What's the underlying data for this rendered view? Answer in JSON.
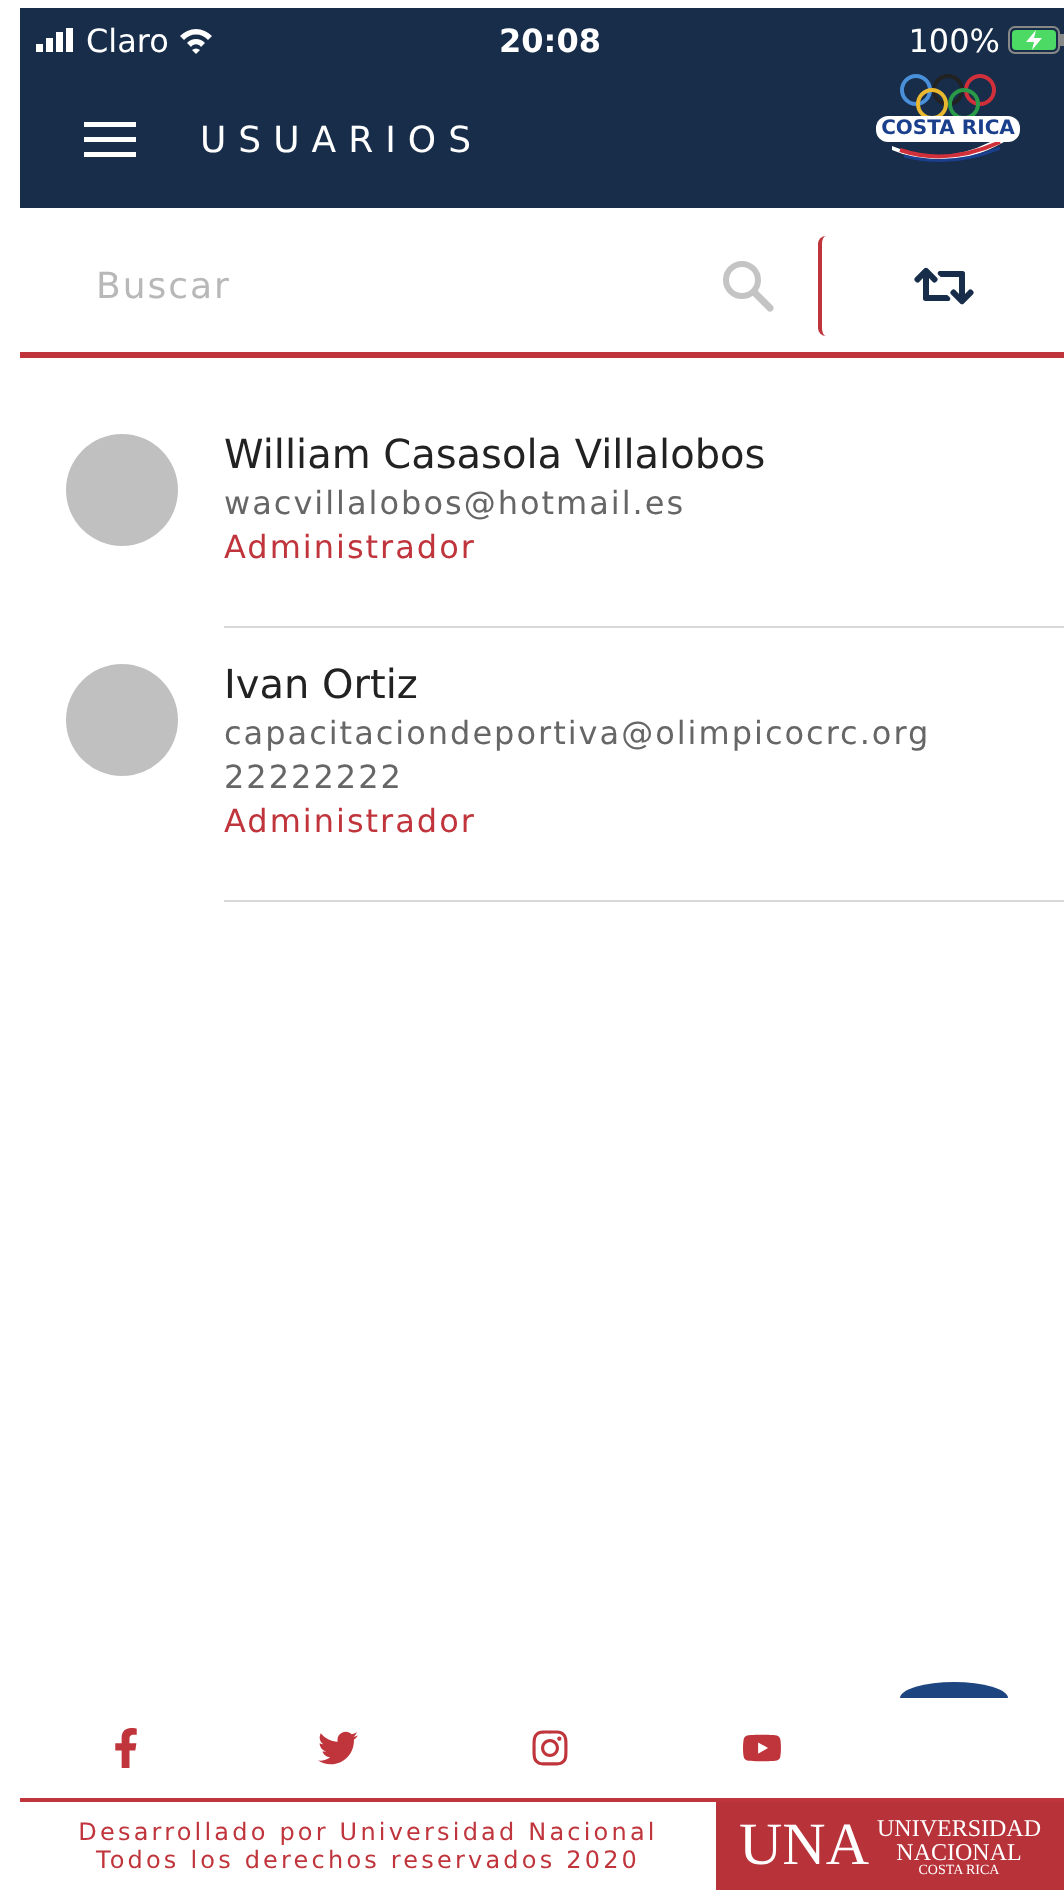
{
  "status_bar": {
    "carrier": "Claro",
    "time": "20:08",
    "battery": "100%"
  },
  "header": {
    "title": "USUARIOS",
    "logo_text": "COSTA RICA"
  },
  "search": {
    "placeholder": "Buscar"
  },
  "users": [
    {
      "name": "William Casasola Villalobos",
      "email": "wacvillalobos@hotmail.es",
      "role": "Administrador"
    },
    {
      "name": "Ivan Ortiz",
      "email": "capacitaciondeportiva@olimpicocrc.org",
      "phone": "22222222",
      "role": "Administrador"
    }
  ],
  "social": [
    {
      "kind": "facebook"
    },
    {
      "kind": "twitter"
    },
    {
      "kind": "instagram"
    },
    {
      "kind": "youtube"
    }
  ],
  "footer": {
    "lines": [
      "Desarrollado por Universidad Nacional",
      "Todos los derechos reservados 2020"
    ],
    "logo": {
      "mark": "UNA",
      "lines": [
        "UNIVERSIDAD",
        "NACIONAL",
        "COSTA RICA"
      ]
    }
  }
}
